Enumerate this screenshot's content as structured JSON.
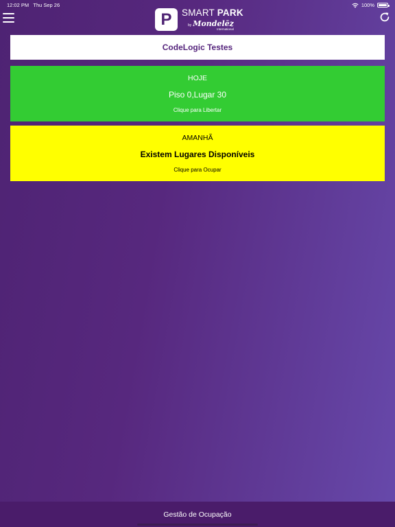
{
  "status_bar": {
    "time": "12:02 PM",
    "date": "Thu Sep 26",
    "battery": "100%",
    "battery_level": 1.0,
    "wifi_icon": "wifi-icon",
    "battery_icon": "battery-icon"
  },
  "header": {
    "menu_icon": "hamburger-menu-icon",
    "refresh_icon": "refresh-icon",
    "logo": {
      "letter": "P",
      "title_light": "SMART ",
      "title_bold": "PARK",
      "by": "by",
      "brand": "Mondelēz",
      "brand_sub": "International"
    }
  },
  "user_card": {
    "name": "CodeLogic Testes"
  },
  "today_card": {
    "day": "HOJE",
    "spot": "Piso 0,Lugar 30",
    "action": "Clique para Libertar",
    "color": "#33cc33"
  },
  "tomorrow_card": {
    "day": "AMANHÃ",
    "status": "Existem Lugares Disponíveis",
    "action": "Clique para Ocupar",
    "color": "#ffff00"
  },
  "footer": {
    "label": "Gestão de Ocupação"
  },
  "colors": {
    "brand_purple": "#55247c",
    "footer_bg": "#4a1c6a"
  }
}
